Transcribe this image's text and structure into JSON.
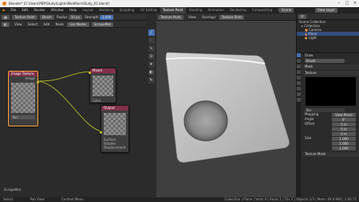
{
  "titlebar": {
    "title": "Blender* [C:\\Users\\PBP\\Study\\Lights\\Modifiers\\Study_01.blend]",
    "minimize": "–",
    "maximize": "□",
    "close": "×"
  },
  "menubar": {
    "items": [
      "File",
      "Edit",
      "Render",
      "Window",
      "Help"
    ],
    "tabs": [
      "Layout",
      "Modeling",
      "Sculpting",
      "UV Editing",
      "Texture Paint",
      "Shading",
      "Animation",
      "Rendering",
      "Compositing",
      "Scripting"
    ],
    "active_tab": "Texture Paint",
    "scene": "Scene",
    "view_layer": "View Layer"
  },
  "node_editor": {
    "header": {
      "mode": "Texture Paint",
      "brush_chip": "Brush",
      "radius_label": "Radius",
      "radius_value": "50 px",
      "strength_label": "Strength",
      "strength_value": "1.000"
    },
    "subheader": [
      "View",
      "Select",
      "Add",
      "Node"
    ],
    "material": "Use Nodes",
    "slot": "ScrapeMat",
    "nodes": {
      "image_texture": {
        "title": "Image Texture",
        "output": "Image",
        "image_name": "Scr"
      },
      "top_node": {
        "title": "Mixed",
        "output": "Color"
      },
      "right_node": {
        "title": "Output",
        "inputs": [
          "Surface",
          "Volume",
          "Displacement"
        ]
      }
    },
    "footer_label": "ScrapeMat"
  },
  "viewport": {
    "header": [
      "View",
      "Overlays",
      "Texture",
      "Brush",
      "Curve",
      "Falloff",
      "Texture Slots"
    ],
    "mode": "Texture Paint"
  },
  "tools": [
    "draw",
    "soften",
    "smear",
    "clone",
    "fill",
    "mask",
    "annotate"
  ],
  "outliner": {
    "title": "Scene Collection",
    "items": [
      "Collection",
      "Camera",
      "Plane",
      "Light"
    ]
  },
  "properties": {
    "tabs_count": 9,
    "tool_label": "Draw",
    "brush_name": "Brush",
    "mask_section": "Mask",
    "rows": [
      {
        "label": "Mapping",
        "value": "View Plane"
      },
      {
        "label": "Angle",
        "value": "0°"
      }
    ],
    "texture_section": "Texture",
    "texture_name": "Scr",
    "offset_label": "Offset",
    "offset_values": [
      "0 m",
      "0 m",
      "0 m"
    ],
    "size_label": "Size",
    "size_values": [
      "1.000",
      "1.000",
      "1.000"
    ],
    "texture_mask": "Texture Mask"
  },
  "statusbar": {
    "left": [
      "Select",
      "Pan View",
      "Context Menu"
    ],
    "right": "Collection | Plane | Verts 4 | Faces 1 | Tris 2 | Objects 1/3 | Mem: 49.0 MiB | 2.80.75"
  }
}
